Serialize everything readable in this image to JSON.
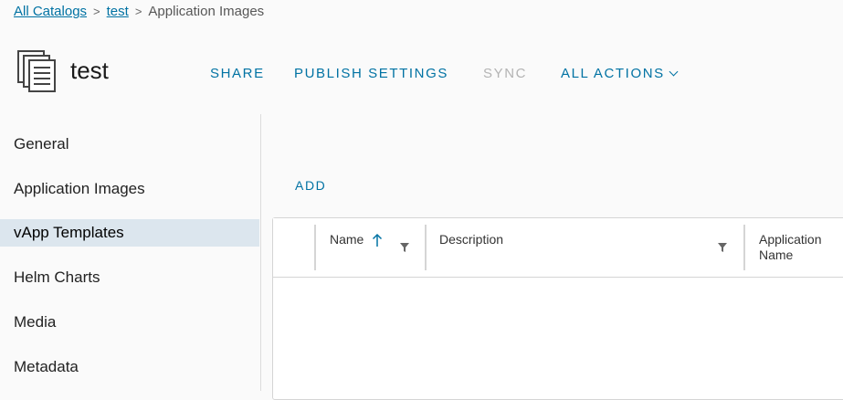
{
  "breadcrumb": {
    "items": [
      {
        "label": "All Catalogs",
        "link": true
      },
      {
        "label": "test",
        "link": true
      },
      {
        "label": "Application Images",
        "link": false
      }
    ],
    "separator": ">"
  },
  "header": {
    "title": "test",
    "icon": "catalog-stack-icon",
    "actions": [
      {
        "label": "SHARE",
        "enabled": true
      },
      {
        "label": "PUBLISH SETTINGS",
        "enabled": true
      },
      {
        "label": "SYNC",
        "enabled": false
      },
      {
        "label": "ALL ACTIONS",
        "enabled": true,
        "dropdown": true
      }
    ]
  },
  "sidebar": {
    "items": [
      {
        "label": "General"
      },
      {
        "label": "Application Images"
      },
      {
        "label": "vApp Templates",
        "active": true
      },
      {
        "label": "Helm Charts"
      },
      {
        "label": "Media"
      },
      {
        "label": "Metadata"
      }
    ]
  },
  "main": {
    "add_label": "ADD",
    "grid": {
      "columns": [
        {
          "label": "Name",
          "sort": "ascending",
          "filter": true
        },
        {
          "label": "Description",
          "filter": true
        },
        {
          "label": "Application\nName"
        }
      ],
      "rows": []
    }
  },
  "colors": {
    "accent": "#0072a3",
    "active_nav_bg": "#dce6ee",
    "disabled": "#b3b3b3"
  }
}
